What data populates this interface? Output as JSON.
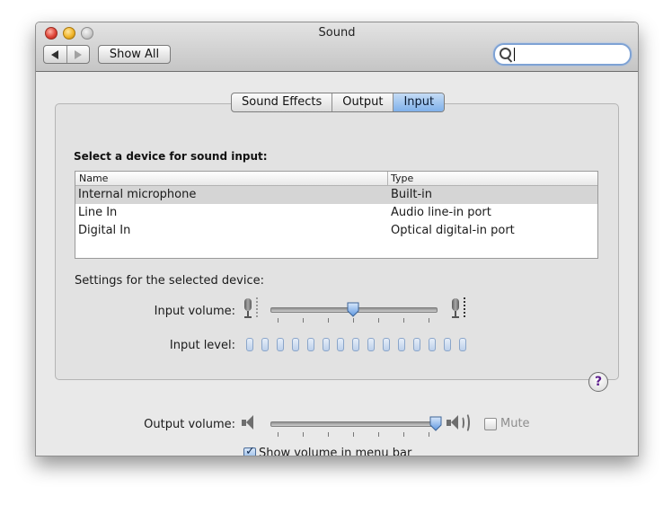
{
  "window": {
    "title": "Sound"
  },
  "toolbar": {
    "show_all_label": "Show All",
    "back_icon": "back-arrow-icon",
    "forward_icon": "forward-arrow-icon"
  },
  "search": {
    "value": "",
    "placeholder": ""
  },
  "tabs": [
    {
      "label": "Sound Effects",
      "selected": false
    },
    {
      "label": "Output",
      "selected": false
    },
    {
      "label": "Input",
      "selected": true
    }
  ],
  "input_pane": {
    "heading": "Select a device for sound input:",
    "columns": [
      "Name",
      "Type"
    ],
    "devices": [
      {
        "name": "Internal microphone",
        "type": "Built-in",
        "selected": true
      },
      {
        "name": "Line In",
        "type": "Audio line-in port",
        "selected": false
      },
      {
        "name": "Digital In",
        "type": "Optical digital-in port",
        "selected": false
      }
    ],
    "settings_label": "Settings for the selected device:",
    "input_volume_label": "Input volume:",
    "input_volume_fraction": 0.5,
    "input_level_label": "Input level:",
    "input_level_segments": 15,
    "input_level_active": 0
  },
  "output": {
    "output_volume_label": "Output volume:",
    "output_volume_fraction": 1.0,
    "mute_label": "Mute",
    "mute_checked": false,
    "mute_enabled": false,
    "show_volume_label": "Show volume in menu bar",
    "show_volume_checked": true
  },
  "help": {
    "symbol": "?"
  },
  "colors": {
    "tab_selected": "#7fb0ea",
    "level_segment": "#bdd0ea",
    "help_mark": "#5b1c8c"
  }
}
